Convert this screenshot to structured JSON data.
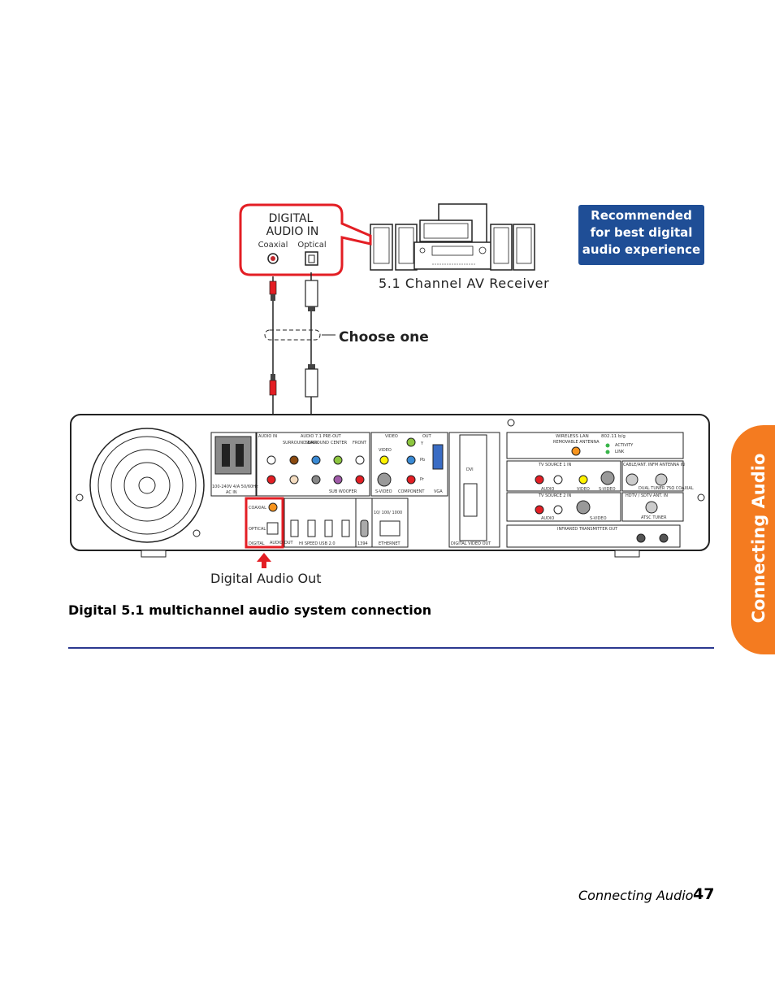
{
  "side_tab": {
    "label": "Connecting Audio",
    "color": "#f47b20"
  },
  "recommended_box": {
    "lines": [
      "Recommended",
      "for best digital",
      "audio experience"
    ],
    "color": "#1f4e96"
  },
  "callout": {
    "title_line1": "DIGITAL",
    "title_line2": "AUDIO IN",
    "coaxial": "Coaxial",
    "optical": "Optical",
    "border_color": "#e31e24"
  },
  "receiver_label": "5.1 Channel AV Receiver",
  "choose_one": "Choose one",
  "digital_audio_out": "Digital Audio Out",
  "panel": {
    "ac": {
      "rating": "100-240V 4/A 50/60Hz",
      "label": "AC IN"
    },
    "audio_in": "AUDIO IN",
    "preout": "AUDIO 7.1 PRE-OUT",
    "surround_back": "SURROUND BACK",
    "surround": "SURROUND",
    "center": "CENTER",
    "front": "FRONT",
    "sub_woofer": "SUB WOOFER",
    "video": "VIDEO",
    "out": "OUT",
    "video_jack": "VIDEO",
    "y": "Y",
    "pb": "Pb",
    "pr": "Pr",
    "svideo": "S-VIDEO",
    "component": "COMPONENT",
    "vga": "VGA",
    "coaxial": "COAXIAL",
    "optical": "OPTICAL",
    "digital": "DIGITAL",
    "audio_out": "AUDIO OUT",
    "usb": "HI SPEED USB 2.0",
    "firewire": "1394",
    "ethernet_speed": "10/ 100/ 1000",
    "ethernet": "ETHERNET",
    "dvi": "DVI",
    "digital_video_out": "DIGITAL VIDEO OUT",
    "wireless": "WIRELESS LAN",
    "wireless_std": "802.11 b/g",
    "removable_antenna": "REMOVABLE ANTENNA",
    "activity": "ACTIVITY",
    "link": "LINK",
    "tv_source_1": "TV SOURCE   1   IN",
    "tv_source_2": "TV SOURCE   2   IN",
    "audio": "AUDIO",
    "tv_video": "VIDEO",
    "tv_svideo": "S-VIDEO",
    "cable_ant": "CABLE/ANT. IN",
    "fm_ant": "FM ANTENNA IN",
    "dual_tuner": "DUAL TUNER",
    "coax75": "75Ω COAXIAL",
    "hdtv": "HDTV / SDTV ANT. IN",
    "atsc": "ATSC TUNER",
    "infrared": "INFRARED TRANSMITTER OUT"
  },
  "caption": "Digital 5.1 multichannel audio system connection",
  "footer": {
    "section": "Connecting Audio",
    "page": "47"
  },
  "rule_color": "#2b3990"
}
